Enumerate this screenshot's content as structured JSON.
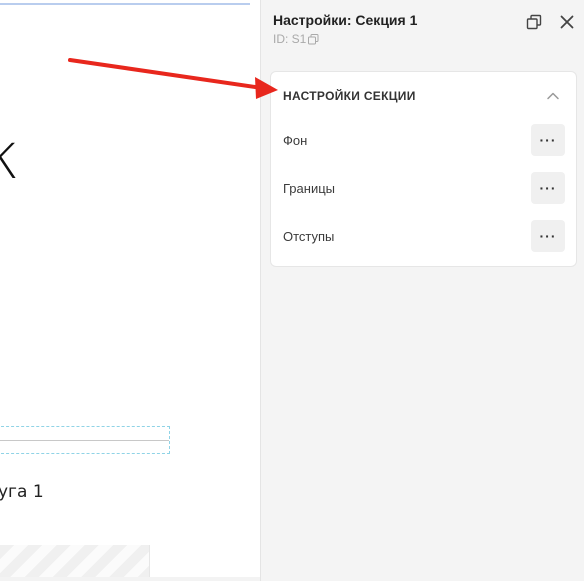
{
  "canvas": {
    "glyph": "К",
    "service_text": "уга 1"
  },
  "panel": {
    "title": "Настройки: Секция 1",
    "id_label": "ID: S1",
    "detach_icon": "detach-window-icon",
    "close_icon": "close-icon",
    "section": {
      "title": "НАСТРОЙКИ СЕКЦИИ",
      "toggle_icon": "chevron-up-icon",
      "items": [
        {
          "label": "Фон",
          "action": "···"
        },
        {
          "label": "Границы",
          "action": "···"
        },
        {
          "label": "Отступы",
          "action": "···"
        }
      ]
    }
  },
  "colors": {
    "arrow": "#e8271d",
    "panel_bg": "#f4f4f4",
    "card_bg": "#ffffff",
    "button_bg": "#f0f0f0",
    "dashed_outline": "#8fd3e6"
  }
}
